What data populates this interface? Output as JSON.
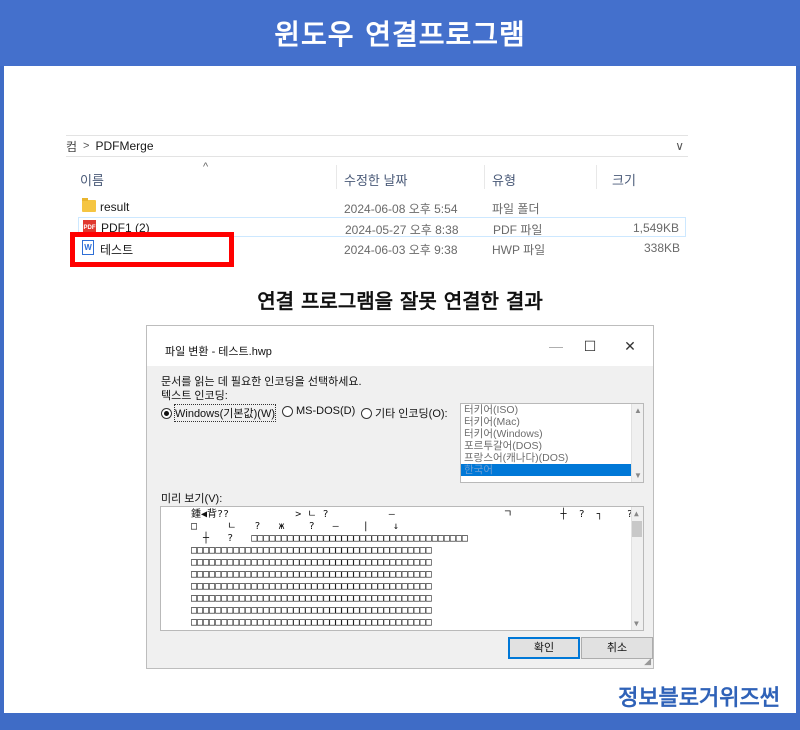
{
  "banner": {
    "title": "윈도우 연결프로그램"
  },
  "explorer": {
    "address_prefix": "컴",
    "address_sep": ">",
    "address_folder": "PDFMerge",
    "address_chevron": "∨",
    "sort_glyph": "^",
    "columns": {
      "name": "이름",
      "date": "수정한 날짜",
      "type": "유형",
      "size": "크기"
    },
    "files": [
      {
        "name": "result",
        "icon": "folder-icon",
        "date": "2024-06-08 오후 5:54",
        "type": "파일 폴더",
        "size": ""
      },
      {
        "name": "PDF1 (2)",
        "icon": "pdf-icon",
        "date": "2024-05-27 오후 8:38",
        "type": "PDF 파일",
        "size": "1,549KB"
      },
      {
        "name": "테스트",
        "icon": "hwp-icon",
        "date": "2024-06-03 오후 9:38",
        "type": "HWP 파일",
        "size": "338KB"
      }
    ],
    "icon_labels": {
      "pdf": "PDF",
      "hwp": "W"
    }
  },
  "caption": "연결 프로그램을 잘못 연결한 결과",
  "dialog": {
    "title": "파일 변환 - 테스트.hwp",
    "window_buttons": {
      "minimize": "—",
      "maximize": "☐",
      "close": "✕"
    },
    "instruction": "문서를 읽는 데 필요한 인코딩을 선택하세요.",
    "encoding_label": "텍스트 인코딩:",
    "radios": [
      {
        "label": "Windows(기본값)(W)",
        "selected": true
      },
      {
        "label": "MS-DOS(D)",
        "selected": false
      },
      {
        "label": "기타 인코딩(O):",
        "selected": false
      }
    ],
    "encodings": [
      "터키어(ISO)",
      "터키어(Mac)",
      "터키어(Windows)",
      "포르투갈어(DOS)",
      "프랑스어(캐나다)(DOS)",
      "한국어"
    ],
    "selected_encoding": "한국어",
    "preview_label": "미리 보기(V):",
    "preview_lines": [
      "鍾◀背??           > ㄴ ?          –                  ㄱ        ┼  ?  ┐    ?□",
      "□     ㄴ   ?   ж    ?   –    |    ↓",
      "  ┼   ?   □□□□□□□□□□□□□□□□□□□□□□□□□□□□□□□□□□□□",
      "□□□□□□□□□□□□□□□□□□□□□□□□□□□□□□□□□□□□□□□□",
      "□□□□□□□□□□□□□□□□□□□□□□□□□□□□□□□□□□□□□□□□",
      "□□□□□□□□□□□□□□□□□□□□□□□□□□□□□□□□□□□□□□□□",
      "□□□□□□□□□□□□□□□□□□□□□□□□□□□□□□□□□□□□□□□□",
      "□□□□□□□□□□□□□□□□□□□□□□□□□□□□□□□□□□□□□□□□",
      "□□□□□□□□□□□□□□□□□□□□□□□□□□□□□□□□□□□□□□□□",
      "□□□□□□□□□□□□□□□□□□□□□□□□□□□□□□□□□□□□□□□□"
    ],
    "ok_label": "확인",
    "cancel_label": "취소"
  },
  "brand": "정보블로거위즈썬",
  "colors": {
    "banner": "#4470cc",
    "highlight_box": "#ff0000",
    "brand": "#2f62b8"
  }
}
